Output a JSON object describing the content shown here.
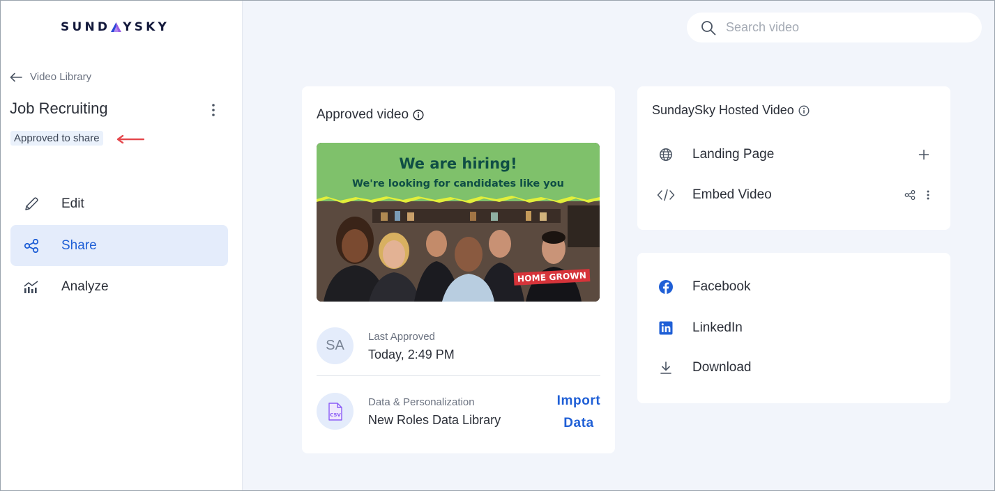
{
  "brand": {
    "logo_left": "SUND",
    "logo_right": "YSKY",
    "accent": "#1f5fd6",
    "logo_triangle": [
      "#2a49d6",
      "#9b5de5",
      "#b48cf0"
    ]
  },
  "sidebar": {
    "back_label": "Video Library",
    "project_title": "Job Recruiting",
    "status_badge": "Approved to share",
    "nav": [
      {
        "label": "Edit",
        "icon": "pencil-icon",
        "active": false
      },
      {
        "label": "Share",
        "icon": "share-icon",
        "active": true
      },
      {
        "label": "Analyze",
        "icon": "analytics-icon",
        "active": false
      }
    ]
  },
  "search": {
    "placeholder": "Search video",
    "icon": "search-icon"
  },
  "approved_card": {
    "title": "Approved video",
    "thumbnail": {
      "headline": "We are hiring!",
      "subheadline": "We're looking for candidates like you",
      "tag": "HOME GROWN"
    },
    "avatar_initials": "SA",
    "last_approved_label": "Last Approved",
    "last_approved_value": "Today, 2:49 PM",
    "data_label": "Data & Personalization",
    "data_value": "New Roles Data Library",
    "csv_icon_text": "CSV",
    "import_line1": "Import",
    "import_line2": "Data"
  },
  "hosted_card": {
    "title": "SundaySky Hosted Video",
    "rows": [
      {
        "label": "Landing Page",
        "icon": "globe-icon"
      },
      {
        "label": "Embed Video",
        "icon": "code-icon"
      }
    ]
  },
  "social_card": {
    "rows": [
      {
        "label": "Facebook",
        "icon": "facebook-icon"
      },
      {
        "label": "LinkedIn",
        "icon": "linkedin-icon"
      },
      {
        "label": "Download",
        "icon": "download-icon"
      }
    ]
  }
}
